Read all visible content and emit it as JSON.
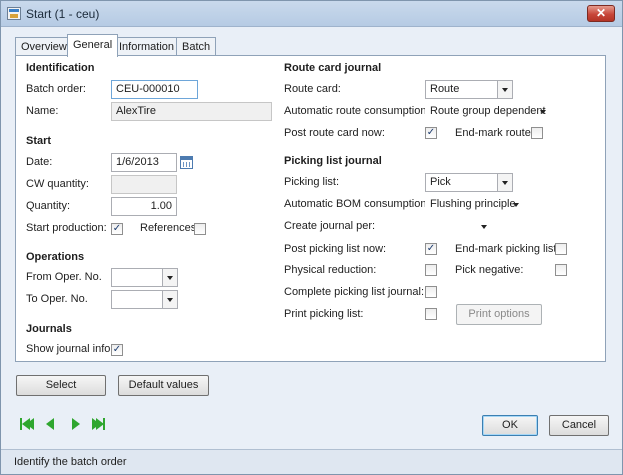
{
  "window": {
    "title": "Start (1 - ceu)",
    "close_glyph": "✕"
  },
  "tabs": [
    "Overview",
    "General",
    "Information",
    "Batch"
  ],
  "identification": {
    "heading": "Identification",
    "batch_order_label": "Batch order:",
    "batch_order_value": "CEU-000010",
    "name_label": "Name:",
    "name_value": "AlexTire"
  },
  "start": {
    "heading": "Start",
    "date_label": "Date:",
    "date_value": "1/6/2013",
    "cw_quantity_label": "CW quantity:",
    "cw_quantity_value": "",
    "quantity_label": "Quantity:",
    "quantity_value": "1.00",
    "start_production_label": "Start production:",
    "start_production_checked": true,
    "references_label": "References:",
    "references_checked": false
  },
  "operations": {
    "heading": "Operations",
    "from_label": "From Oper. No.",
    "from_value": "",
    "to_label": "To Oper. No.",
    "to_value": ""
  },
  "journals": {
    "heading": "Journals",
    "show_info_label": "Show journal info:",
    "show_info_checked": true
  },
  "route_card": {
    "heading": "Route card journal",
    "route_card_label": "Route card:",
    "route_card_value": "Route",
    "auto_consumption_label": "Automatic route consumption:",
    "auto_consumption_value": "Route group dependent",
    "post_now_label": "Post route card now:",
    "post_now_checked": true,
    "end_mark_label": "End-mark route:",
    "end_mark_checked": false
  },
  "picking": {
    "heading": "Picking list journal",
    "picking_list_label": "Picking list:",
    "picking_list_value": "Pick",
    "auto_bom_label": "Automatic BOM consumption:",
    "auto_bom_value": "Flushing principle",
    "create_per_label": "Create journal per:",
    "create_per_value": "",
    "post_now_label": "Post picking list now:",
    "post_now_checked": true,
    "end_mark_label": "End-mark picking list:",
    "end_mark_checked": false,
    "physical_reduction_label": "Physical reduction:",
    "physical_reduction_checked": false,
    "pick_negative_label": "Pick negative:",
    "pick_negative_checked": false,
    "complete_label": "Complete picking list journal:",
    "complete_checked": false,
    "print_label": "Print picking list:",
    "print_checked": false,
    "print_options_label": "Print options"
  },
  "buttons": {
    "select": "Select",
    "default_values": "Default values",
    "ok": "OK",
    "cancel": "Cancel"
  },
  "check_glyph": "✓",
  "status": {
    "text": "Identify the batch order"
  }
}
